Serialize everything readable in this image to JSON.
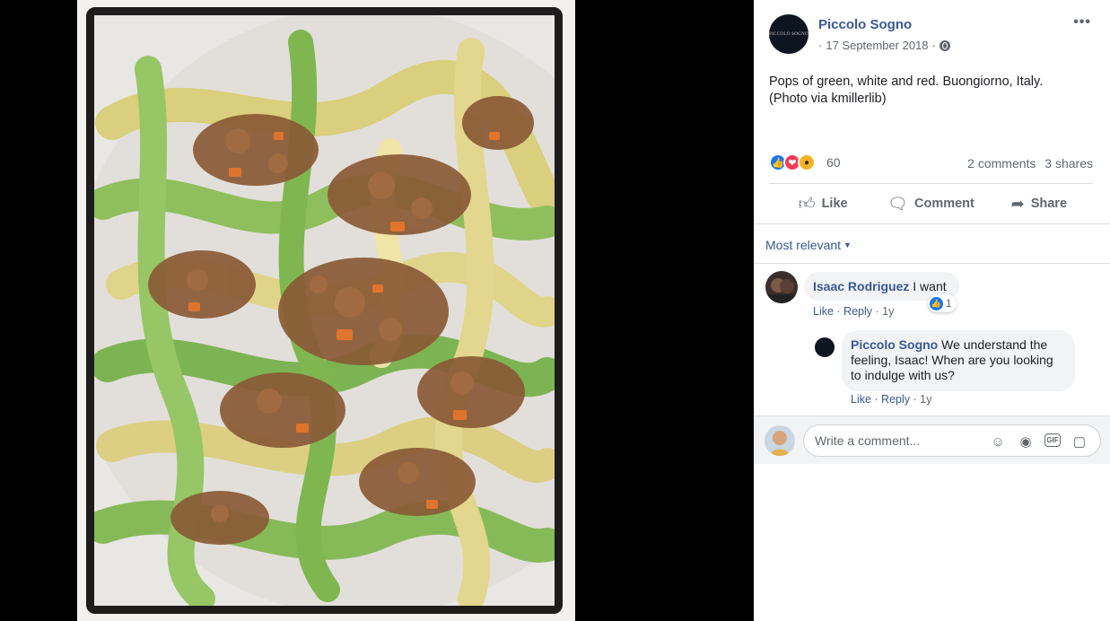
{
  "post": {
    "page_name": "Piccolo Sogno",
    "avatar_text": "PICCOLO SOGNO",
    "meta_prefix": "·",
    "date": "17 September 2018",
    "meta_sep": "·",
    "privacy_icon": "globe-icon",
    "more_label": "•••",
    "text_line1": "Pops of green, white and red. Buongiorno, Italy.",
    "text_line2": "(Photo via kmillerlib)"
  },
  "reactions": {
    "icons": [
      "like-icon",
      "love-icon",
      "wow-icon"
    ],
    "count": "60",
    "comments": "2 comments",
    "shares": "3 shares"
  },
  "actions": {
    "like": "Like",
    "comment": "Comment",
    "share": "Share"
  },
  "sort": {
    "label": "Most relevant"
  },
  "comments": [
    {
      "author": "Isaac Rodriguez",
      "text": " I want",
      "like": "Like",
      "reply": "Reply",
      "sep": " · ",
      "age": "1y",
      "reaction_count": "1"
    },
    {
      "author": "Piccolo Sogno",
      "text": " We understand the feeling, Isaac! When are you looking to indulge with us?",
      "like": "Like",
      "reply": "Reply",
      "sep": " · ",
      "age": "1y"
    }
  ],
  "composer": {
    "placeholder": "Write a comment...",
    "icons": [
      "emoji-icon",
      "camera-icon",
      "gif-icon",
      "sticker-icon"
    ],
    "gif_label": "GIF"
  },
  "colors": {
    "link_blue": "#385898",
    "like_blue": "#1877f2",
    "love_red": "#f33e58",
    "wow_yellow": "#f7b125",
    "meta_gray": "#606770"
  }
}
